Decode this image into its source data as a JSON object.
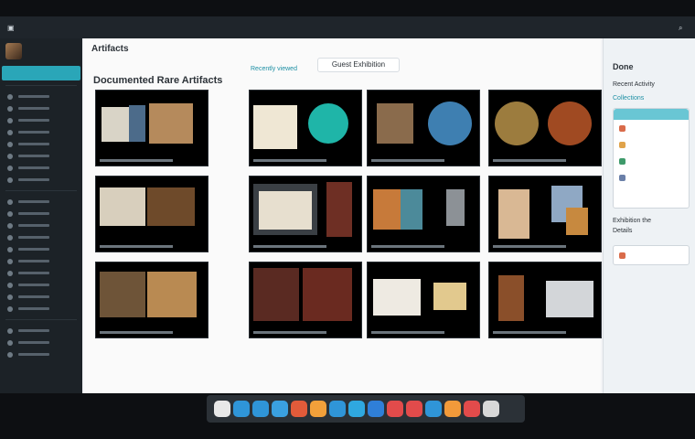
{
  "top_bar": {
    "segments": [
      "",
      "",
      "",
      "",
      "",
      ""
    ]
  },
  "sidebar": {
    "profile_name": "",
    "active_item": "",
    "items": [
      "",
      "",
      "",
      "",
      "",
      "",
      "",
      "",
      "",
      "",
      "",
      "",
      "",
      "",
      "",
      "",
      "",
      "",
      "",
      "",
      ""
    ]
  },
  "main": {
    "title": "Artifacts",
    "subtitle": "Documented Rare Artifacts",
    "center_tab": "Guest Exhibition",
    "small_link": "Recently viewed"
  },
  "gallery": {
    "items": [
      {
        "caption": ""
      },
      {
        "caption": ""
      },
      {
        "caption": ""
      },
      {
        "caption": ""
      },
      {
        "caption": ""
      },
      {
        "caption": ""
      },
      {
        "caption": ""
      },
      {
        "caption": ""
      },
      {
        "caption": ""
      },
      {
        "caption": ""
      },
      {
        "caption": ""
      },
      {
        "caption": ""
      }
    ]
  },
  "right_panel": {
    "title": "Done",
    "subtitle": "Recent Activity",
    "subtitle2": "Collections",
    "rows": [
      "",
      "",
      "",
      ""
    ],
    "section": "Exhibition the",
    "section2": "Details",
    "bottom_card": ""
  },
  "dock": {
    "icons": [
      "folder",
      "mail",
      "chat",
      "browser",
      "notes",
      "files",
      "calendar",
      "settings",
      "photos",
      "music",
      "store",
      "help",
      "video",
      "camera",
      "search"
    ]
  },
  "colors": {
    "accent": "#2aa6b8",
    "sidebar_bg": "#1c2227",
    "topbar_bg": "#1f252b"
  }
}
